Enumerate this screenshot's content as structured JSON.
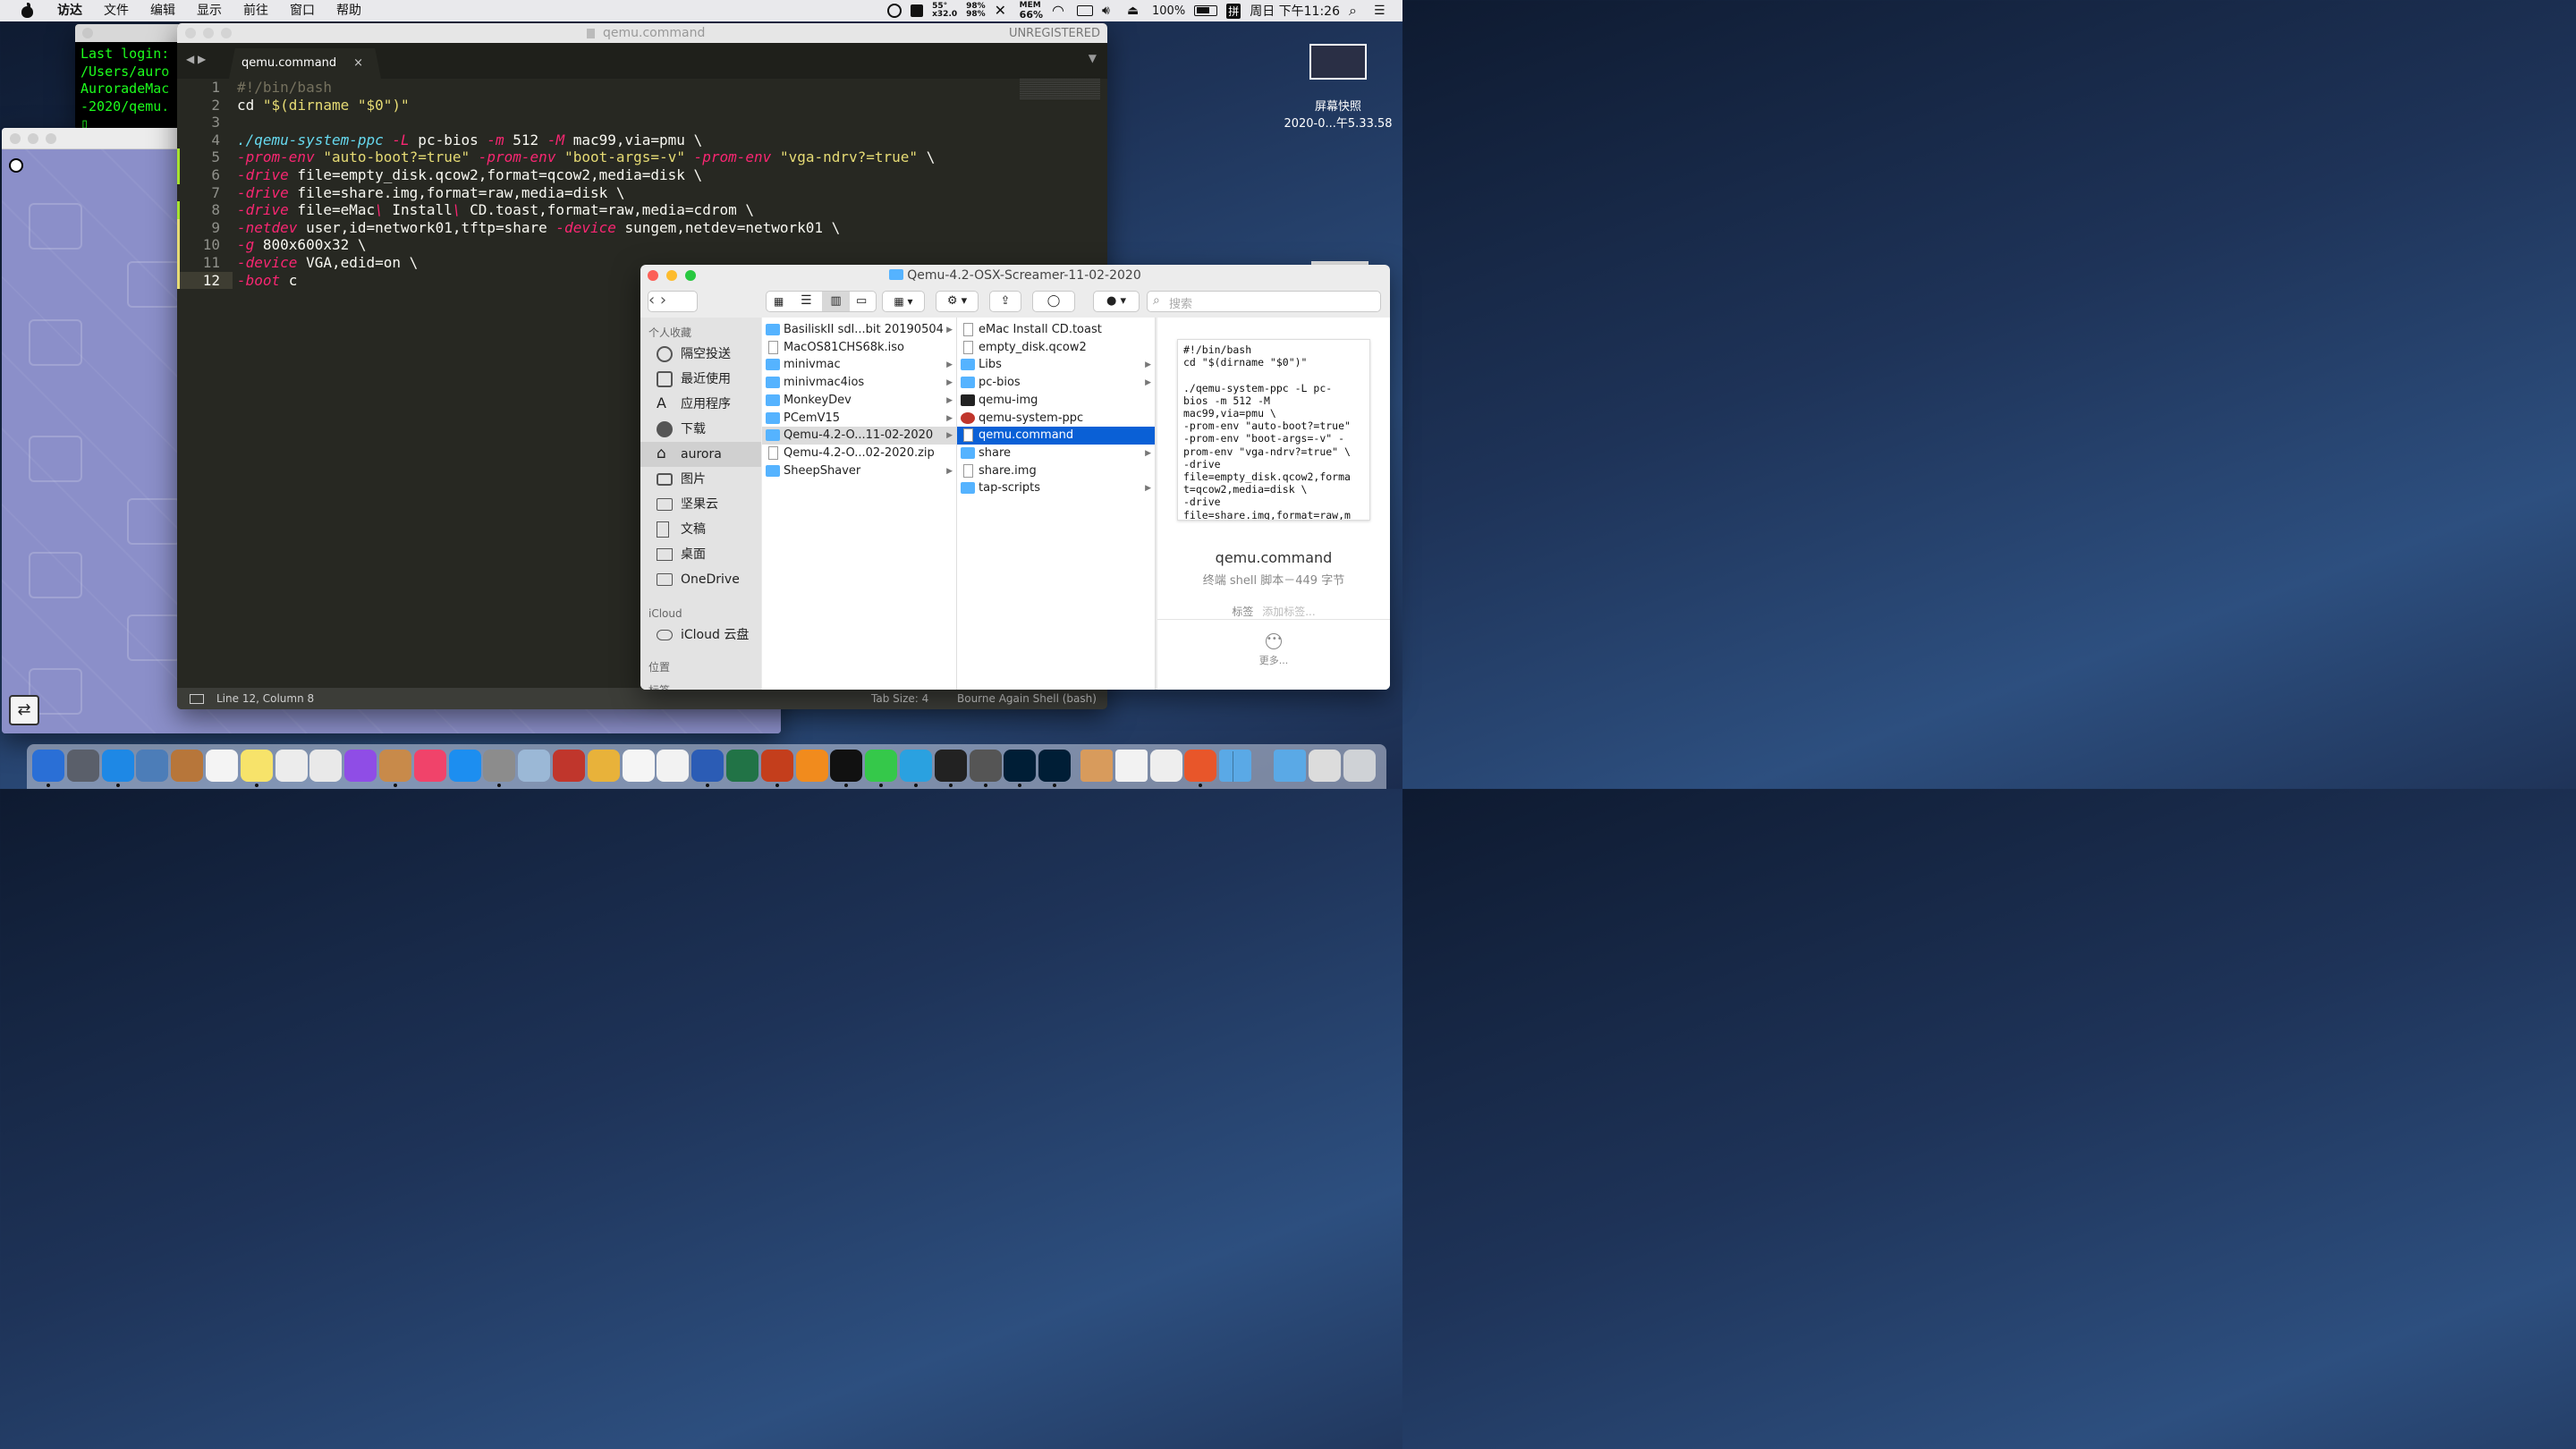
{
  "menubar": {
    "items": [
      "访达",
      "文件",
      "编辑",
      "显示",
      "前往",
      "窗口",
      "帮助"
    ],
    "temp": "55°",
    "temp_sub": "x32.0",
    "cpu": "98%",
    "cpu_sub": "98%",
    "mem_label": "MEM",
    "mem": "66%",
    "battery": "100%",
    "input_method": "拼",
    "clock": "周日 下午11:26"
  },
  "desktop": {
    "screenshot_name": "屏幕快照",
    "screenshot_date": "2020-0...午5.33.58"
  },
  "terminal": {
    "lines": [
      "Last login:",
      "/Users/auro",
      "AuroradeMac",
      "-2020/qemu.",
      "▯"
    ]
  },
  "editor": {
    "title": "qemu.command",
    "unregistered": "UNREGISTERED",
    "tab": "qemu.command",
    "status_position": "Line 12, Column 8",
    "tab_size": "Tab Size: 4",
    "syntax": "Bourne Again Shell (bash)",
    "lines": [
      {
        "n": "1",
        "segs": [
          [
            "c",
            "#!/bin/bash"
          ]
        ]
      },
      {
        "n": "2",
        "segs": [
          [
            "p",
            "cd "
          ],
          [
            "s",
            "\"$(dirname \"$0\")\""
          ]
        ]
      },
      {
        "n": "3",
        "segs": [
          [
            "p",
            ""
          ]
        ]
      },
      {
        "n": "4",
        "segs": [
          [
            "f",
            "./qemu-system-ppc"
          ],
          [
            "p",
            " "
          ],
          [
            "k",
            "-L"
          ],
          [
            "p",
            " pc-bios "
          ],
          [
            "k",
            "-m"
          ],
          [
            "p",
            " 512 "
          ],
          [
            "k",
            "-M"
          ],
          [
            "p",
            " mac99,via=pmu \\"
          ]
        ]
      },
      {
        "n": "5",
        "segs": [
          [
            "k",
            "-prom-env"
          ],
          [
            "p",
            " "
          ],
          [
            "s",
            "\"auto-boot?=true\""
          ],
          [
            "p",
            " "
          ],
          [
            "k",
            "-prom-env"
          ],
          [
            "p",
            " "
          ],
          [
            "s",
            "\"boot-args=-v\""
          ],
          [
            "p",
            " "
          ],
          [
            "k",
            "-prom-env"
          ],
          [
            "p",
            " "
          ],
          [
            "s",
            "\"vga-ndrv?=true\""
          ],
          [
            "p",
            " \\"
          ]
        ]
      },
      {
        "n": "6",
        "segs": [
          [
            "k",
            "-drive"
          ],
          [
            "p",
            " file=empty_disk.qcow2,format=qcow2,media=disk \\"
          ]
        ]
      },
      {
        "n": "7",
        "segs": [
          [
            "k",
            "-drive"
          ],
          [
            "p",
            " file=share.img,format=raw,media=disk \\"
          ]
        ]
      },
      {
        "n": "8",
        "segs": [
          [
            "k",
            "-drive"
          ],
          [
            "p",
            " file=eMac"
          ],
          [
            "k",
            "\\"
          ],
          [
            "p",
            " Install"
          ],
          [
            "k",
            "\\"
          ],
          [
            "p",
            " CD.toast,format=raw,media=cdrom \\"
          ]
        ]
      },
      {
        "n": "9",
        "segs": [
          [
            "k",
            "-netdev"
          ],
          [
            "p",
            " user,id=network01,tftp=share "
          ],
          [
            "k",
            "-device"
          ],
          [
            "p",
            " sungem,netdev=network01 \\"
          ]
        ]
      },
      {
        "n": "10",
        "segs": [
          [
            "k",
            "-g"
          ],
          [
            "p",
            " 800x600x32 \\"
          ]
        ]
      },
      {
        "n": "11",
        "segs": [
          [
            "k",
            "-device"
          ],
          [
            "p",
            " VGA,edid=on \\"
          ]
        ]
      },
      {
        "n": "12",
        "segs": [
          [
            "k",
            "-boot"
          ],
          [
            "p",
            " c"
          ]
        ]
      }
    ]
  },
  "finder": {
    "title": "Qemu-4.2-OSX-Screamer-11-02-2020",
    "search_placeholder": "搜索",
    "favorites_header": "个人收藏",
    "sidebar": [
      "隔空投送",
      "最近使用",
      "应用程序",
      "下载",
      "aurora",
      "图片",
      "坚果云",
      "文稿",
      "桌面",
      "OneDrive"
    ],
    "icloud_header": "iCloud",
    "icloud_item": "iCloud 云盘",
    "location_header": "位置",
    "location_cut": "标签",
    "col1": [
      {
        "name": "BasiliskII sdl...bit 20190504",
        "type": "folder",
        "arrow": true
      },
      {
        "name": "MacOS81CHS68k.iso",
        "type": "doc",
        "arrow": false
      },
      {
        "name": "minivmac",
        "type": "folder",
        "arrow": true
      },
      {
        "name": "minivmac4ios",
        "type": "folder",
        "arrow": true
      },
      {
        "name": "MonkeyDev",
        "type": "folder",
        "arrow": true
      },
      {
        "name": "PCemV15",
        "type": "folder",
        "arrow": true
      },
      {
        "name": "Qemu-4.2-O...11-02-2020",
        "type": "folder",
        "arrow": true
      },
      {
        "name": "Qemu-4.2-O...02-2020.zip",
        "type": "doc",
        "arrow": false
      },
      {
        "name": "SheepShaver",
        "type": "folder",
        "arrow": true
      }
    ],
    "col2": [
      {
        "name": "eMac Install CD.toast",
        "type": "doc",
        "arrow": false
      },
      {
        "name": "empty_disk.qcow2",
        "type": "doc",
        "arrow": false
      },
      {
        "name": "Libs",
        "type": "folder",
        "arrow": true
      },
      {
        "name": "pc-bios",
        "type": "folder",
        "arrow": true
      },
      {
        "name": "qemu-img",
        "type": "exec",
        "arrow": false
      },
      {
        "name": "qemu-system-ppc",
        "type": "app",
        "arrow": false
      },
      {
        "name": "qemu.command",
        "type": "doc",
        "arrow": false
      },
      {
        "name": "share",
        "type": "folder",
        "arrow": true
      },
      {
        "name": "share.img",
        "type": "doc",
        "arrow": false
      },
      {
        "name": "tap-scripts",
        "type": "folder",
        "arrow": true
      }
    ],
    "preview_text": "#!/bin/bash\ncd \"$(dirname \"$0\")\"\n\n./qemu-system-ppc -L pc-\nbios -m 512 -M\nmac99,via=pmu \\\n-prom-env \"auto-boot?=true\"\n-prom-env \"boot-args=-v\" -\nprom-env \"vga-ndrv?=true\" \\\n-drive\nfile=empty_disk.qcow2,forma\nt=qcow2,media=disk \\\n-drive\nfile=share.img,format=raw,m\nedia=disk \\",
    "preview_name": "qemu.command",
    "preview_info": "终端 shell 脚本－449 字节",
    "tags_label": "标签",
    "tags_placeholder": "添加标签...",
    "more": "更多..."
  },
  "dock": {
    "colors": [
      "#2a6fd6",
      "#5a5f6a",
      "#1e88e5",
      "#4c7db8",
      "#b7763a",
      "#f4f4f4",
      "#f7e36a",
      "#ececec",
      "#e9e9e9",
      "#8f4de6",
      "#c88a4a",
      "#f0436a",
      "#1c8ef0",
      "#8c8c8c",
      "#9bb8d6",
      "#c0362c",
      "#e8b23a",
      "#f5f5f5",
      "#f2f2f2",
      "#2b5cb5",
      "#217346",
      "#c43e1c",
      "#f18b1d",
      "#111111",
      "#35c84a",
      "#2aa1e0",
      "#222222",
      "#555555",
      "#001e36",
      "#001e36",
      "#d89b5c",
      "#f2f2f2",
      "#eeeeee",
      "#e8562a",
      "#5aa9e6",
      "#5aa9e6",
      "#dcdcdc",
      "#cfd2d6"
    ]
  }
}
